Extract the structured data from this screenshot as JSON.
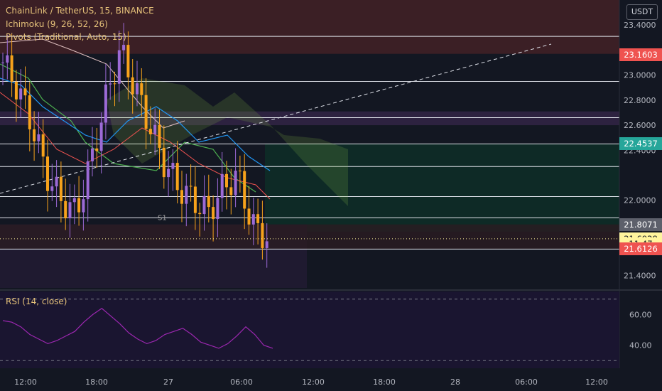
{
  "header": {
    "symbol_line": "ChainLink / TetherUS, 15, BINANCE",
    "indicator_1": "Ichimoku (9, 26, 52, 26)",
    "indicator_2": "Pivots (Traditional, Auto, 15)",
    "currency_badge": "USDT"
  },
  "rsi": {
    "label": "RSI (14, close)",
    "ticks": [
      "60.00",
      "40.00"
    ]
  },
  "price_axis": {
    "ticks": [
      "23.4000",
      "23.0000",
      "22.8000",
      "22.6000",
      "22.4000",
      "22.0000",
      "21.4000"
    ],
    "tags": [
      {
        "text": "23.1603",
        "value": 23.1603,
        "bg": "#ef5350",
        "fg": "#ffffff"
      },
      {
        "text": "22.4537",
        "value": 22.4537,
        "bg": "#26a69a",
        "fg": "#ffffff"
      },
      {
        "text": "21.8071",
        "value": 21.8071,
        "bg": "#5d606b",
        "fg": "#ffffff"
      },
      {
        "text": "21.6928",
        "value": 21.6928,
        "bg": "#fff59d",
        "fg": "#131722"
      },
      {
        "text": "11:47",
        "value": 21.65,
        "bg": "#fff59d",
        "fg": "#131722"
      },
      {
        "text": "21.6126",
        "value": 21.6126,
        "bg": "#ef5350",
        "fg": "#ffffff"
      }
    ]
  },
  "time_axis": {
    "ticks": [
      "12:00",
      "18:00",
      "27",
      "06:00",
      "12:00",
      "18:00",
      "28",
      "06:00",
      "12:00"
    ]
  },
  "colors": {
    "background": "#131722",
    "up": "#9c6ad6",
    "down": "#f7a21b",
    "pivot": "#e0e3eb",
    "rsi": "#9c27b0"
  },
  "chart_data": {
    "type": "line",
    "title": "ChainLink / TetherUS, 15, BINANCE",
    "pivot_levels": [
      23.31,
      22.95,
      22.66,
      22.45,
      22.27,
      22.03,
      21.86,
      21.61
    ],
    "pivot_labels": [
      "S1"
    ],
    "ylim": [
      21.3,
      23.6
    ],
    "close_approx": [
      23.1,
      22.9,
      22.6,
      22.2,
      22.0,
      21.9,
      22.3,
      22.8,
      23.2,
      22.9,
      22.6,
      22.3,
      22.1,
      22.0,
      21.9,
      22.1,
      22.2,
      21.8,
      21.7
    ],
    "rsi_values": [
      56,
      55,
      52,
      47,
      44,
      41,
      43,
      46,
      49,
      55,
      60,
      64,
      59,
      54,
      48,
      44,
      41,
      43,
      47,
      49,
      51,
      47,
      42,
      40,
      38,
      41,
      46,
      52,
      47,
      40,
      38
    ]
  }
}
